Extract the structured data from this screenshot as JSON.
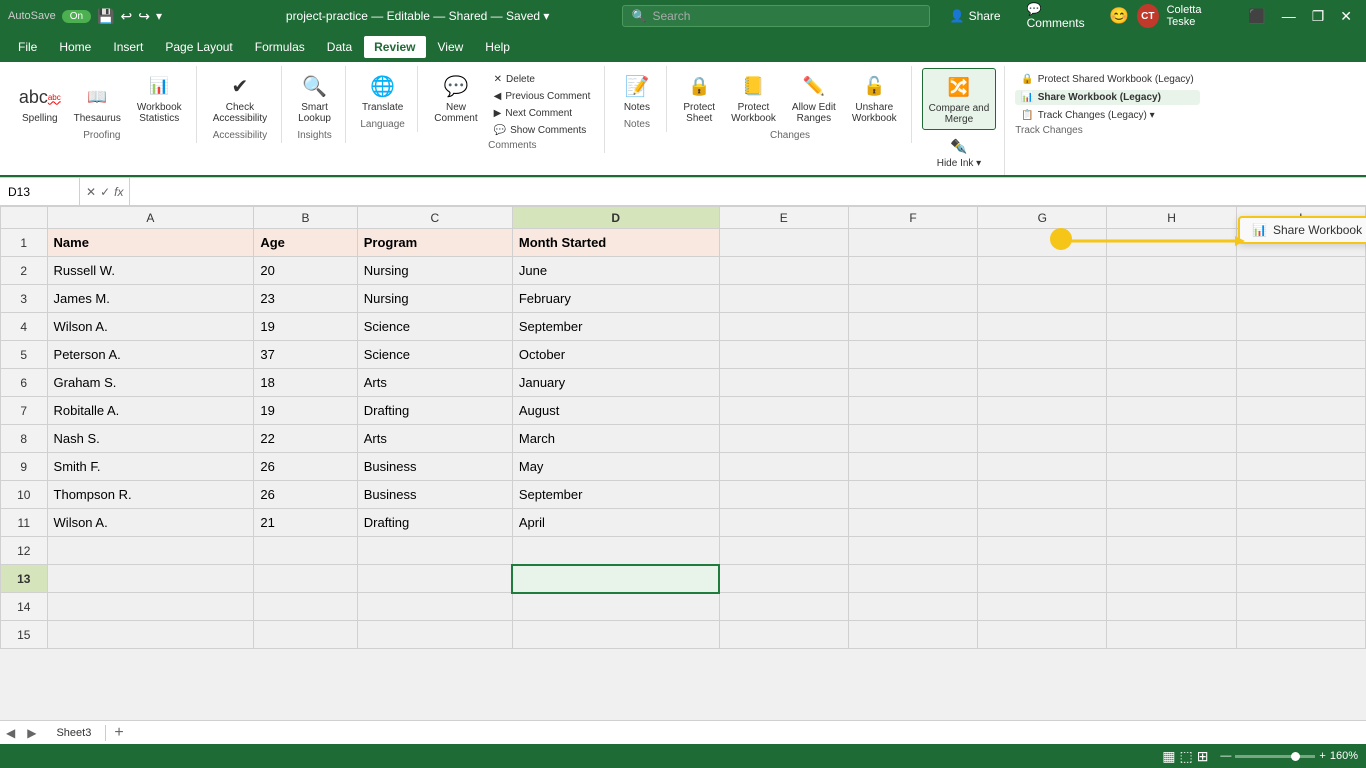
{
  "titleBar": {
    "autosave": "AutoSave",
    "autosaveState": "On",
    "filename": "project-practice",
    "editStatus": "Editable",
    "shareStatus": "Shared",
    "saveStatus": "Saved",
    "searchPlaceholder": "Search",
    "userName": "Coletta Teske",
    "userInitials": "CT"
  },
  "menuItems": [
    "File",
    "Home",
    "Insert",
    "Page Layout",
    "Formulas",
    "Data",
    "Review",
    "View",
    "Help"
  ],
  "activeMenu": "Review",
  "ribbon": {
    "groups": {
      "proofing": {
        "label": "Proofing",
        "buttons": [
          "Spelling",
          "Thesaurus",
          "Workbook Statistics"
        ]
      },
      "accessibility": {
        "label": "Accessibility",
        "buttons": [
          "Check Accessibility"
        ]
      },
      "insights": {
        "label": "Insights",
        "buttons": [
          "Smart Lookup"
        ]
      },
      "language": {
        "label": "Language",
        "buttons": [
          "Translate"
        ]
      },
      "comments": {
        "label": "Comments",
        "buttons": [
          "New Comment",
          "Delete",
          "Previous Comment",
          "Next Comment",
          "Show Comments"
        ]
      },
      "notes": {
        "label": "Notes",
        "buttons": [
          "Notes"
        ]
      },
      "changes": {
        "label": "Changes",
        "buttons": [
          "Protect Sheet",
          "Protect Workbook",
          "Allow Edit Ranges",
          "Unshare Workbook"
        ]
      },
      "compareMerge": {
        "label": "",
        "buttons": [
          "Compare and Merge Workbooks"
        ]
      },
      "hideInk": {
        "label": "",
        "buttons": [
          "Hide Ink"
        ]
      },
      "trackChanges": {
        "label": "Track Changes",
        "items": [
          "Protect Shared Workbook (Legacy)",
          "Share Workbook (Legacy)",
          "Track Changes (Legacy) ▾"
        ]
      }
    }
  },
  "tooltip": {
    "label": "Share Workbook (Legacy)",
    "icon": "📊"
  },
  "formulaBar": {
    "nameBox": "D13",
    "formula": ""
  },
  "columns": [
    "",
    "A",
    "B",
    "C",
    "D",
    "E",
    "F",
    "G",
    "H",
    "I"
  ],
  "rows": [
    {
      "num": 1,
      "cells": [
        "Name",
        "Age",
        "Program",
        "Month Started",
        "",
        "",
        "",
        "",
        ""
      ]
    },
    {
      "num": 2,
      "cells": [
        "Russell W.",
        "20",
        "Nursing",
        "June",
        "",
        "",
        "",
        "",
        ""
      ]
    },
    {
      "num": 3,
      "cells": [
        "James M.",
        "23",
        "Nursing",
        "February",
        "",
        "",
        "",
        "",
        ""
      ]
    },
    {
      "num": 4,
      "cells": [
        "Wilson A.",
        "19",
        "Science",
        "September",
        "",
        "",
        "",
        "",
        ""
      ]
    },
    {
      "num": 5,
      "cells": [
        "Peterson A.",
        "37",
        "Science",
        "October",
        "",
        "",
        "",
        "",
        ""
      ]
    },
    {
      "num": 6,
      "cells": [
        "Graham S.",
        "18",
        "Arts",
        "January",
        "",
        "",
        "",
        "",
        ""
      ]
    },
    {
      "num": 7,
      "cells": [
        "Robitalle A.",
        "19",
        "Drafting",
        "August",
        "",
        "",
        "",
        "",
        ""
      ]
    },
    {
      "num": 8,
      "cells": [
        "Nash S.",
        "22",
        "Arts",
        "March",
        "",
        "",
        "",
        "",
        ""
      ]
    },
    {
      "num": 9,
      "cells": [
        "Smith F.",
        "26",
        "Business",
        "May",
        "",
        "",
        "",
        "",
        ""
      ]
    },
    {
      "num": 10,
      "cells": [
        "Thompson R.",
        "26",
        "Business",
        "September",
        "",
        "",
        "",
        "",
        ""
      ]
    },
    {
      "num": 11,
      "cells": [
        "Wilson A.",
        "21",
        "Drafting",
        "April",
        "",
        "",
        "",
        "",
        ""
      ]
    },
    {
      "num": 12,
      "cells": [
        "",
        "",
        "",
        "",
        "",
        "",
        "",
        "",
        ""
      ]
    },
    {
      "num": 13,
      "cells": [
        "",
        "",
        "",
        "",
        "",
        "",
        "",
        "",
        ""
      ]
    },
    {
      "num": 14,
      "cells": [
        "",
        "",
        "",
        "",
        "",
        "",
        "",
        "",
        ""
      ]
    },
    {
      "num": 15,
      "cells": [
        "",
        "",
        "",
        "",
        "",
        "",
        "",
        "",
        ""
      ]
    }
  ],
  "selectedCell": "D13",
  "selectedRow": 13,
  "selectedCol": "D",
  "bottomBar": {
    "sheetTabs": [
      "Sheet3"
    ],
    "activeTab": "Sheet3",
    "viewIcons": [
      "grid",
      "page",
      "preview"
    ],
    "zoom": "160%",
    "zoomValue": 160
  }
}
